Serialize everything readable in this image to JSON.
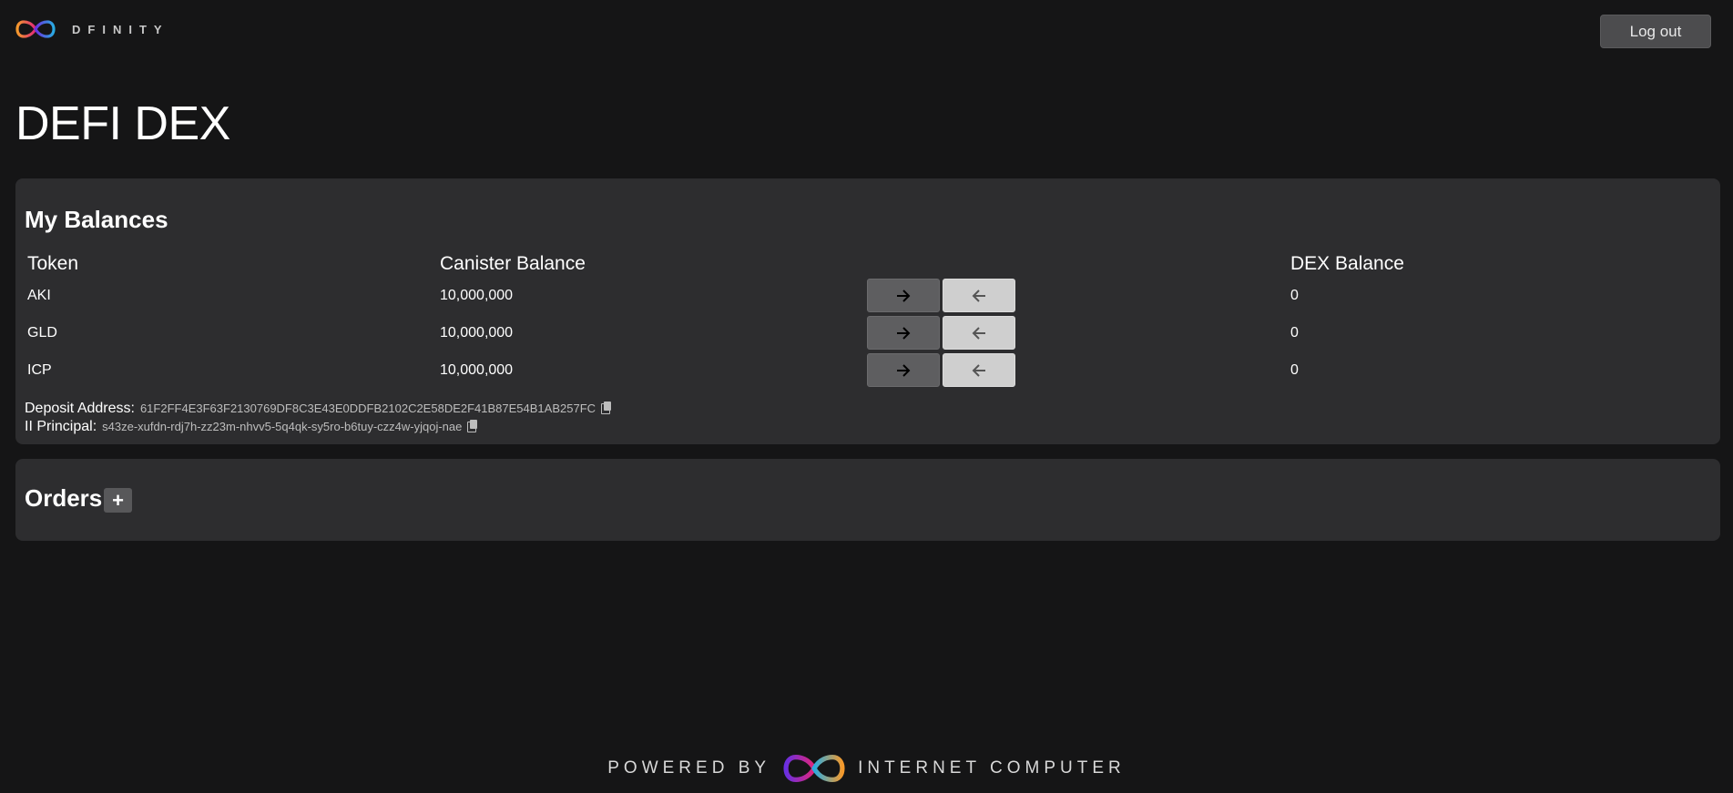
{
  "header": {
    "brand": "DFINITY",
    "logout_label": "Log out"
  },
  "page_title": "DEFI DEX",
  "balances": {
    "title": "My Balances",
    "columns": {
      "token": "Token",
      "canister": "Canister Balance",
      "dex": "DEX Balance"
    },
    "rows": [
      {
        "token": "AKI",
        "canister_balance": "10,000,000",
        "dex_balance": "0"
      },
      {
        "token": "GLD",
        "canister_balance": "10,000,000",
        "dex_balance": "0"
      },
      {
        "token": "ICP",
        "canister_balance": "10,000,000",
        "dex_balance": "0"
      }
    ],
    "deposit_address_label": "Deposit Address:",
    "deposit_address": "61F2FF4E3F63F2130769DF8C3E43E0DDFB2102C2E58DE2F41B87E54B1AB257FC",
    "principal_label": "II Principal:",
    "principal": "s43ze-xufdn-rdj7h-zz23m-nhvv5-5q4qk-sy5ro-b6tuy-czz4w-yjqoj-nae"
  },
  "orders": {
    "title": "Orders",
    "add_label": "+"
  },
  "footer": {
    "powered_by": "POWERED BY",
    "product": "INTERNET COMPUTER"
  },
  "icons": {
    "brand_logo": "infinity-logo-icon",
    "deposit": "arrow-right-icon",
    "withdraw": "arrow-left-icon",
    "copy": "copy-icon"
  },
  "colors": {
    "background": "#151516",
    "card": "#2d2d2f",
    "logo_orange": "#f59a2c",
    "logo_pink": "#e0257a",
    "logo_purple": "#6a2fe0",
    "logo_blue": "#29abe2"
  }
}
